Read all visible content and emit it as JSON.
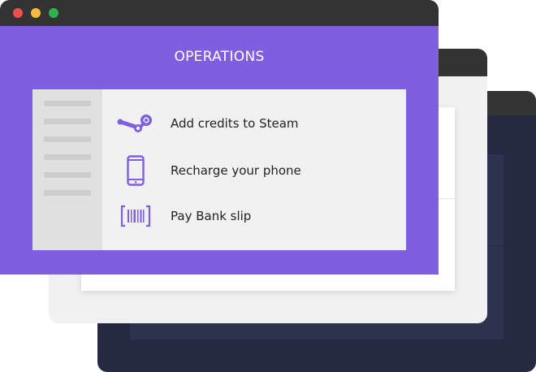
{
  "window": {
    "title": "OPERATIONS",
    "controls": [
      "close",
      "minimize",
      "maximize"
    ]
  },
  "colors": {
    "accent": "#7f5fe0",
    "titlebar": "#333333",
    "dark_window": "#252a42",
    "light_window": "#f1f1f1"
  },
  "menu": {
    "items": [
      {
        "label": "Add credits to Steam",
        "icon": "steam-icon"
      },
      {
        "label": "Recharge your phone",
        "icon": "phone-icon"
      },
      {
        "label": "Pay Bank slip",
        "icon": "barcode-icon"
      }
    ]
  }
}
